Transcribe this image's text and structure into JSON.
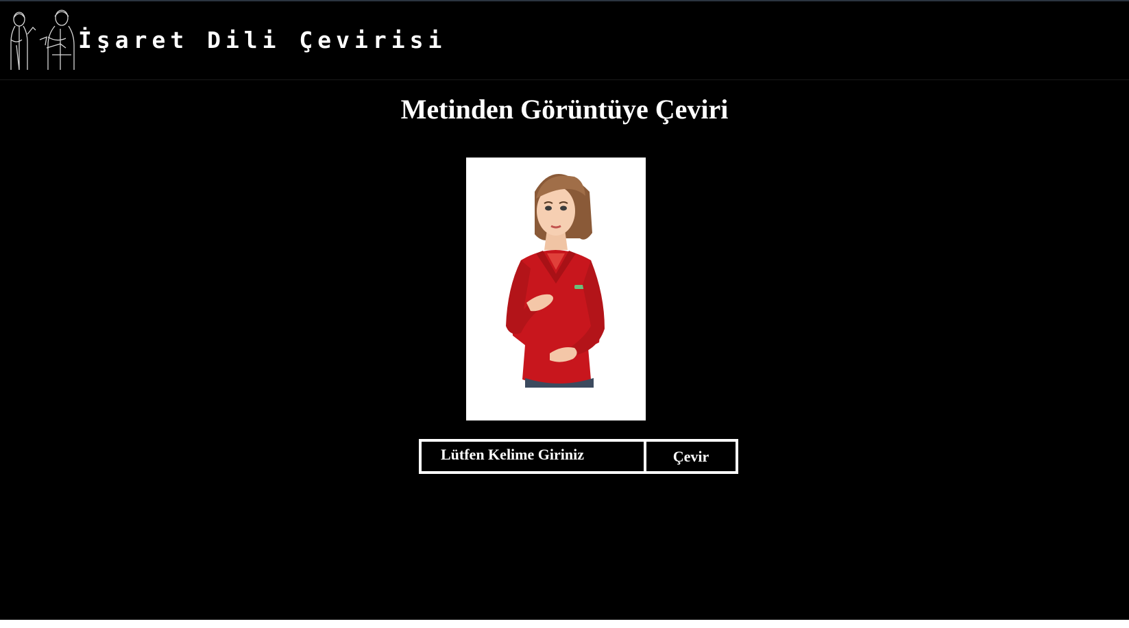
{
  "header": {
    "site_title": "İşaret Dili Çevirisi",
    "logo_icon": "sign-language-people-icon"
  },
  "main": {
    "title": "Metinden Görüntüye Çeviri",
    "avatar": "sign-language-avatar"
  },
  "form": {
    "input_placeholder": "Lütfen Kelime Giriniz",
    "input_value": "",
    "button_label": "Çevir"
  },
  "colors": {
    "background": "#000000",
    "text": "#ffffff",
    "avatar_shirt": "#c8161d",
    "avatar_hair": "#9a6a45"
  }
}
